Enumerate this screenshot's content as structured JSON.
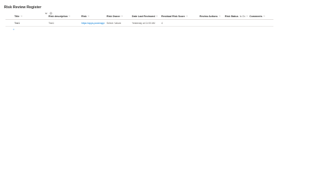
{
  "page": {
    "title": "Risk Review Register"
  },
  "columns": {
    "title": "Title",
    "risk_description": "Risk description",
    "risk": "Risk",
    "risk_owner": "Risk Owner",
    "date_last_reviewed": "Date Last Reviewed",
    "residual_risk_score": "Residual Risk Score",
    "review_actions": "Review Actions",
    "risk_status": "Risk Status",
    "risk_status_filter": "Is Ov",
    "comments": "Comments"
  },
  "rows": [
    {
      "title": "Test1",
      "risk_description": "Test1",
      "risk": "https://apps.powerapps.com/...",
      "risk_owner": "Select: Values",
      "date_last_reviewed": "Yesterday at 11:00 AM",
      "residual_risk_score": "4",
      "review_actions": "",
      "risk_status": "",
      "comments": ""
    }
  ],
  "icons": {
    "title_dropdown": "chevron-down-icon",
    "title_settings": "settings-icon",
    "column_sort": "chevron-down-icon",
    "new_item": "new-item-sparkle-icon"
  },
  "colors": {
    "text": "#323130",
    "subtle_text": "#605e5c",
    "link": "#0078d4",
    "divider": "#e1dfdd"
  }
}
